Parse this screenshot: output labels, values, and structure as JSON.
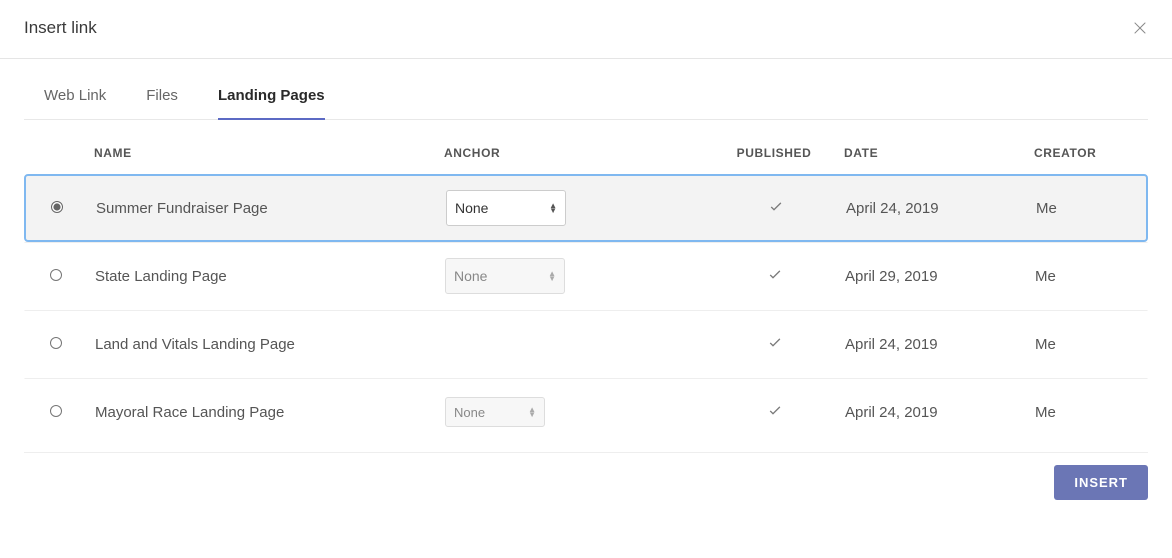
{
  "header": {
    "title": "Insert link"
  },
  "tabs": {
    "web_link": "Web Link",
    "files": "Files",
    "landing_pages": "Landing Pages",
    "active": "landing_pages"
  },
  "columns": {
    "name": "Name",
    "anchor": "Anchor",
    "published": "Published",
    "date": "Date",
    "creator": "Creator"
  },
  "rows": [
    {
      "name": "Summer Fundraiser Page",
      "anchor": "None",
      "anchor_enabled": true,
      "published": true,
      "date": "April 24, 2019",
      "creator": "Me",
      "selected": true
    },
    {
      "name": "State Landing Page",
      "anchor": "None",
      "anchor_enabled": true,
      "anchor_disabled_style": true,
      "published": true,
      "date": "April 29, 2019",
      "creator": "Me",
      "selected": false
    },
    {
      "name": "Land and Vitals Landing Page",
      "anchor": null,
      "anchor_enabled": false,
      "published": true,
      "date": "April 24, 2019",
      "creator": "Me",
      "selected": false
    },
    {
      "name": "Mayoral Race Landing Page",
      "anchor": "None",
      "anchor_enabled": true,
      "anchor_disabled_style": true,
      "anchor_small": true,
      "published": true,
      "date": "April 24, 2019",
      "creator": "Me",
      "selected": false
    }
  ],
  "anchor_options": [
    "None"
  ],
  "footer": {
    "insert_label": "INSERT"
  }
}
